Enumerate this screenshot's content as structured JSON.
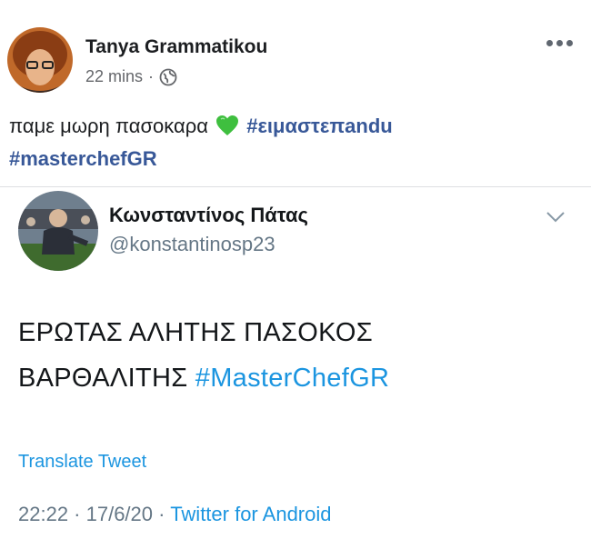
{
  "facebook_post": {
    "author_name": "Tanya Grammatikou",
    "time": "22 mins",
    "separator": "·",
    "privacy_icon": "globe-icon",
    "more_icon": "more-options-icon",
    "text_lead": "παμε μωρη πασοκαρα",
    "emoji": "green-heart",
    "hashtag_1": "#ειμαστεπandu",
    "hashtag_2": "#masterchefGR"
  },
  "tweet": {
    "display_name": "Κωνσταντίνος Πάτας",
    "handle": "@konstantinosp23",
    "menu_icon": "chevron-down-icon",
    "text_line_1": "ΕΡΩΤΑΣ ΑΛΗΤΗΣ ΠΑΣΟΚΟΣ",
    "text_line_2_lead": "ΒΑΡΘΑΛΙΤΗΣ",
    "hashtag": "#MasterChefGR",
    "translate_label": "Translate Tweet",
    "timestamp": "22:22 · 17/6/20",
    "meta_separator": "·",
    "source": "Twitter for Android"
  },
  "colors": {
    "facebook_link": "#385898",
    "twitter_link": "#1b95e0",
    "secondary_text": "#657786"
  }
}
